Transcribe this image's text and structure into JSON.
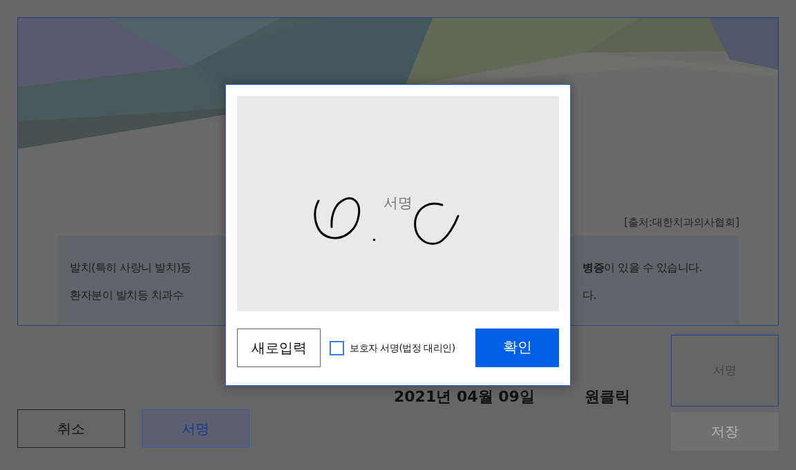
{
  "page": {
    "source": "[출처:대한치과의사협회]",
    "notice_lines": [
      {
        "left": "발치(특히 사랑니 발치)등",
        "right": "**병증**이 있을 수 있습니다."
      },
      {
        "left": "환자분이 발치등 치과수",
        "right": "다."
      }
    ],
    "date": "2021년 04월 09일",
    "signer": "원클릭",
    "signature_box": {
      "label": "서명"
    },
    "buttons": [
      {
        "label": "취소",
        "kind": "outline"
      },
      {
        "label": "서명",
        "kind": "primary"
      }
    ],
    "save_button": {
      "label": "저장",
      "disabled": true
    }
  },
  "dialog": {
    "pad": {
      "placeholder": "서명",
      "signed": true
    },
    "reset_button": "새로입력",
    "guardian": {
      "label": "보호자 서명(법정 대리인)",
      "checked": false
    },
    "confirm_button": "확인"
  }
}
